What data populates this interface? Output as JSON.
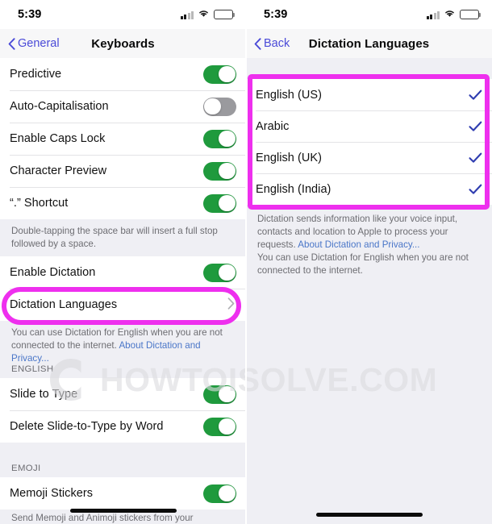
{
  "colors": {
    "highlight": "#ee2fee",
    "toggle_on": "#1f9a3d",
    "toggle_off": "#9a9a9e",
    "link": "#4a76c8",
    "nav_tint": "#4a4ad8",
    "group_bg": "#efeff4"
  },
  "watermark": {
    "text": "HOWTOISOLVE.COM",
    "logo": "copyright-circle-logo"
  },
  "left": {
    "status": {
      "time": "5:39",
      "signal": "cellular-signal-icon",
      "wifi": "wifi-icon",
      "battery": "battery-icon"
    },
    "nav": {
      "back_label": "General",
      "title": "Keyboards"
    },
    "rows": [
      {
        "label": "Predictive",
        "toggle": "on"
      },
      {
        "label": "Auto-Capitalisation",
        "toggle": "off"
      },
      {
        "label": "Enable Caps Lock",
        "toggle": "on"
      },
      {
        "label": "Character Preview",
        "toggle": "on"
      },
      {
        "label": "“.” Shortcut",
        "toggle": "on"
      }
    ],
    "footer1": "Double-tapping the space bar will insert a full stop followed by a space.",
    "dictation_row": {
      "label": "Enable Dictation",
      "toggle": "on"
    },
    "languages_row": {
      "label": "Dictation Languages",
      "disclosure": "chevron-right-icon"
    },
    "footer2_text": "You can use Dictation for English when you are not connected to the internet. ",
    "footer2_link": "About Dictation and Privacy...",
    "english_header": "ENGLISH",
    "english_rows": [
      {
        "label": "Slide to Type",
        "toggle": "on"
      },
      {
        "label": "Delete Slide-to-Type by Word",
        "toggle": "on"
      }
    ],
    "emoji_header": "EMOJI",
    "emoji_rows": [
      {
        "label": "Memoji Stickers",
        "toggle": "on"
      }
    ],
    "emoji_footer_cut": "Send Memoji and Animoji stickers from your"
  },
  "right": {
    "status": {
      "time": "5:39",
      "signal": "cellular-signal-icon",
      "wifi": "wifi-icon",
      "battery": "battery-icon"
    },
    "nav": {
      "back_label": "Back",
      "title": "Dictation Languages"
    },
    "languages": [
      {
        "label": "English (US)",
        "checked": true
      },
      {
        "label": "Arabic",
        "checked": true
      },
      {
        "label": "English (UK)",
        "checked": true
      },
      {
        "label": "English (India)",
        "checked": true
      }
    ],
    "footer1_text": "Dictation sends information like your voice input, contacts and location to Apple to process your requests. ",
    "footer1_link": "About Dictation and Privacy...",
    "footer2": "You can use Dictation for English when you are not connected to the internet."
  }
}
